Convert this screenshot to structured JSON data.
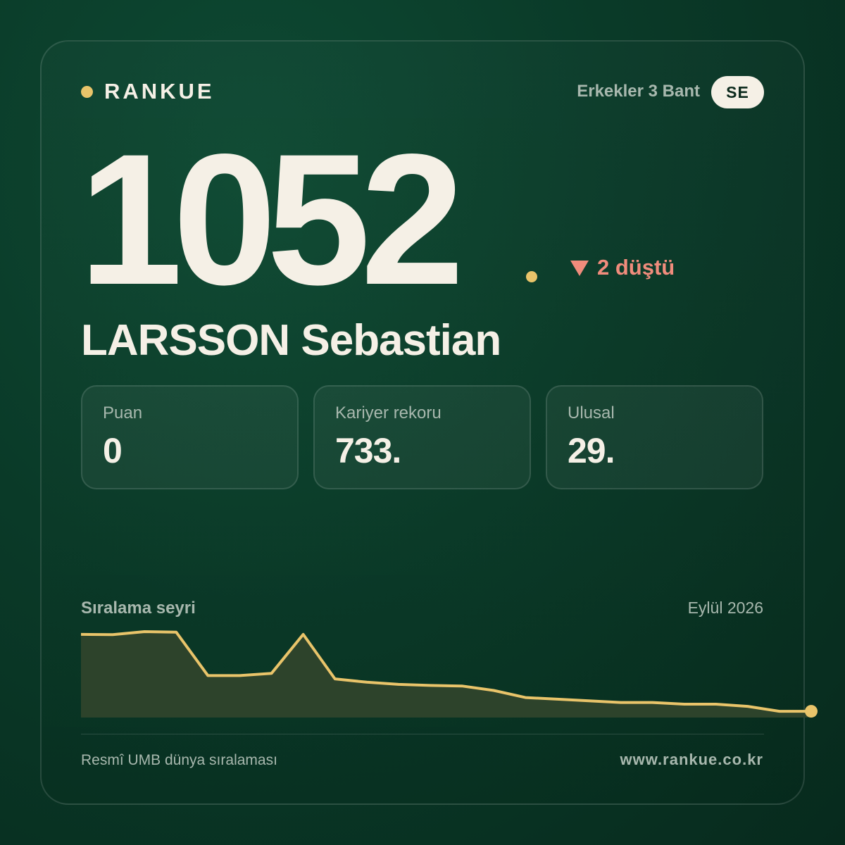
{
  "brand": {
    "name": "RANKUE",
    "accent": "#e9c46a"
  },
  "category": "Erkekler 3 Bant",
  "country_code": "SE",
  "rank": "1052",
  "change": {
    "direction": "down",
    "text": "2 düştü",
    "color": "#f08c7c"
  },
  "player": {
    "name": "LARSSON Sebastian"
  },
  "stats": [
    {
      "label": "Puan",
      "value": "0"
    },
    {
      "label": "Kariyer rekoru",
      "value": "733."
    },
    {
      "label": "Ulusal",
      "value": "29."
    }
  ],
  "chart": {
    "title": "Sıralama seyri",
    "period": "Eylül 2026"
  },
  "chart_data": {
    "type": "area",
    "series": [
      {
        "values": [
          5,
          5.5,
          0,
          1,
          80,
          80,
          76,
          5,
          86,
          92,
          96,
          98,
          99,
          107,
          120,
          123,
          126,
          129,
          129,
          132,
          132,
          136,
          145,
          145
        ]
      }
    ],
    "ylim": [
      0,
      150
    ],
    "inverted_y": true,
    "line_color": "#e9c46a",
    "fill_color": "#2d432b",
    "grid": false
  },
  "footer": {
    "source": "Resmî UMB dünya sıralaması",
    "url": "www.rankue.co.kr"
  }
}
